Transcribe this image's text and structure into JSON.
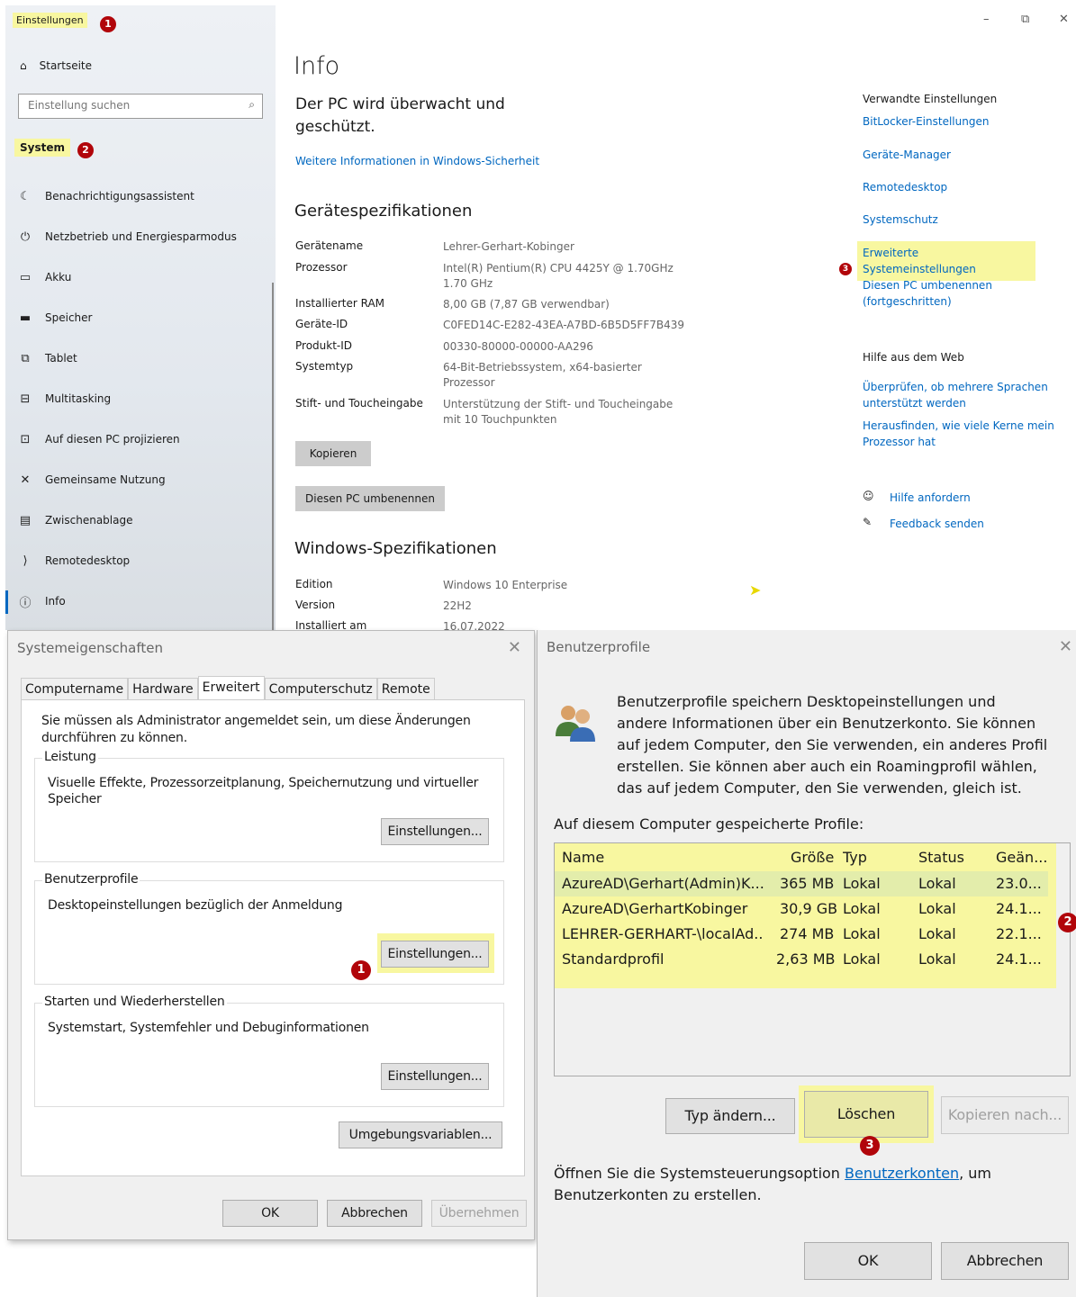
{
  "settings": {
    "app_title": "Einstellungen",
    "home": "Startseite",
    "search_placeholder": "Einstellung suchen",
    "section": "System",
    "nav": [
      {
        "label": "Benachrichtigungsassistent",
        "icon": "moon-icon"
      },
      {
        "label": "Netzbetrieb und Energiesparmodus",
        "icon": "power-icon"
      },
      {
        "label": "Akku",
        "icon": "battery-icon"
      },
      {
        "label": "Speicher",
        "icon": "storage-icon"
      },
      {
        "label": "Tablet",
        "icon": "tablet-icon"
      },
      {
        "label": "Multitasking",
        "icon": "multitasking-icon"
      },
      {
        "label": "Auf diesen PC projizieren",
        "icon": "project-icon"
      },
      {
        "label": "Gemeinsame Nutzung",
        "icon": "share-icon"
      },
      {
        "label": "Zwischenablage",
        "icon": "clipboard-icon"
      },
      {
        "label": "Remotedesktop",
        "icon": "remote-icon"
      },
      {
        "label": "Info",
        "icon": "info-icon"
      }
    ],
    "page_title": "Info",
    "protection": "Der PC wird überwacht und geschützt.",
    "security_link": "Weitere Informationen in Windows-Sicherheit",
    "device_specs_title": "Gerätespezifikationen",
    "device_specs": [
      {
        "key": "Gerätename",
        "value": "Lehrer-Gerhart-Kobinger"
      },
      {
        "key": "Prozessor",
        "value": "Intel(R) Pentium(R) CPU 4425Y @ 1.70GHz 1.70 GHz"
      },
      {
        "key": "Installierter RAM",
        "value": "8,00 GB (7,87 GB verwendbar)"
      },
      {
        "key": "Geräte-ID",
        "value": "C0FED14C-E282-43EA-A7BD-6B5D5FF7B439"
      },
      {
        "key": "Produkt-ID",
        "value": "00330-80000-00000-AA296"
      },
      {
        "key": "Systemtyp",
        "value": "64-Bit-Betriebssystem, x64-basierter Prozessor"
      },
      {
        "key": "Stift- und Toucheingabe",
        "value": "Unterstützung der Stift- und Toucheingabe mit 10 Touchpunkten"
      }
    ],
    "copy_button": "Kopieren",
    "rename_button": "Diesen PC umbenennen",
    "windows_specs_title": "Windows-Spezifikationen",
    "windows_specs": [
      {
        "key": "Edition",
        "value": "Windows 10 Enterprise"
      },
      {
        "key": "Version",
        "value": "22H2"
      },
      {
        "key": "Installiert am",
        "value": "16.07.2022"
      }
    ],
    "related_title": "Verwandte Einstellungen",
    "related": [
      "BitLocker-Einstellungen",
      "Geräte-Manager",
      "Remotedesktop",
      "Systemschutz",
      "Erweiterte Systemeinstellungen",
      "Diesen PC umbenennen (fortgeschritten)"
    ],
    "web_help_title": "Hilfe aus dem Web",
    "web_help": [
      "Überprüfen, ob mehrere Sprachen unterstützt werden",
      "Herausfinden, wie viele Kerne mein Prozessor hat"
    ],
    "get_help": "Hilfe anfordern",
    "feedback": "Feedback senden"
  },
  "sysprops": {
    "title": "Systemeigenschaften",
    "tabs": [
      "Computername",
      "Hardware",
      "Erweitert",
      "Computerschutz",
      "Remote"
    ],
    "active_tab": "Erweitert",
    "admin_note": "Sie müssen als Administrator angemeldet sein, um diese Änderungen durchführen zu können.",
    "groups": [
      {
        "label": "Leistung",
        "desc": "Visuelle Effekte, Prozessorzeitplanung, Speichernutzung und virtueller Speicher",
        "button": "Einstellungen..."
      },
      {
        "label": "Benutzerprofile",
        "desc": "Desktopeinstellungen bezüglich der Anmeldung",
        "button": "Einstellungen..."
      },
      {
        "label": "Starten und Wiederherstellen",
        "desc": "Systemstart, Systemfehler und Debuginformationen",
        "button": "Einstellungen..."
      }
    ],
    "env_button": "Umgebungsvariablen...",
    "ok": "OK",
    "cancel": "Abbrechen",
    "apply": "Übernehmen"
  },
  "profiles": {
    "title": "Benutzerprofile",
    "description": "Benutzerprofile speichern Desktopeinstellungen und andere Informationen über ein Benutzerkonto. Sie können auf jedem Computer, den Sie verwenden, ein anderes Profil erstellen. Sie können aber auch ein Roamingprofil wählen, das auf jedem Computer, den Sie verwenden, gleich ist.",
    "stored_label": "Auf diesem Computer gespeicherte Profile:",
    "columns": [
      "Name",
      "Größe",
      "Typ",
      "Status",
      "Geän..."
    ],
    "rows": [
      {
        "name": "AzureAD\\Gerhart(Admin)K...",
        "size": "365 MB",
        "type": "Lokal",
        "status": "Lokal",
        "changed": "23.0..."
      },
      {
        "name": "AzureAD\\GerhartKobinger",
        "size": "30,9 GB",
        "type": "Lokal",
        "status": "Lokal",
        "changed": "24.1..."
      },
      {
        "name": "LEHRER-GERHART-\\localAd...",
        "size": "274 MB",
        "type": "Lokal",
        "status": "Lokal",
        "changed": "22.1..."
      },
      {
        "name": "Standardprofil",
        "size": "2,63 MB",
        "type": "Lokal",
        "status": "Lokal",
        "changed": "24.1..."
      }
    ],
    "change_type": "Typ ändern...",
    "delete": "Löschen",
    "copy_to": "Kopieren nach...",
    "open_prefix": "Öffnen Sie die Systemsteuerungsoption ",
    "open_link": "Benutzerkonten",
    "open_suffix": ", um Benutzerkonten zu erstellen.",
    "ok": "OK",
    "cancel": "Abbrechen"
  },
  "markers": [
    "1",
    "2",
    "3"
  ]
}
